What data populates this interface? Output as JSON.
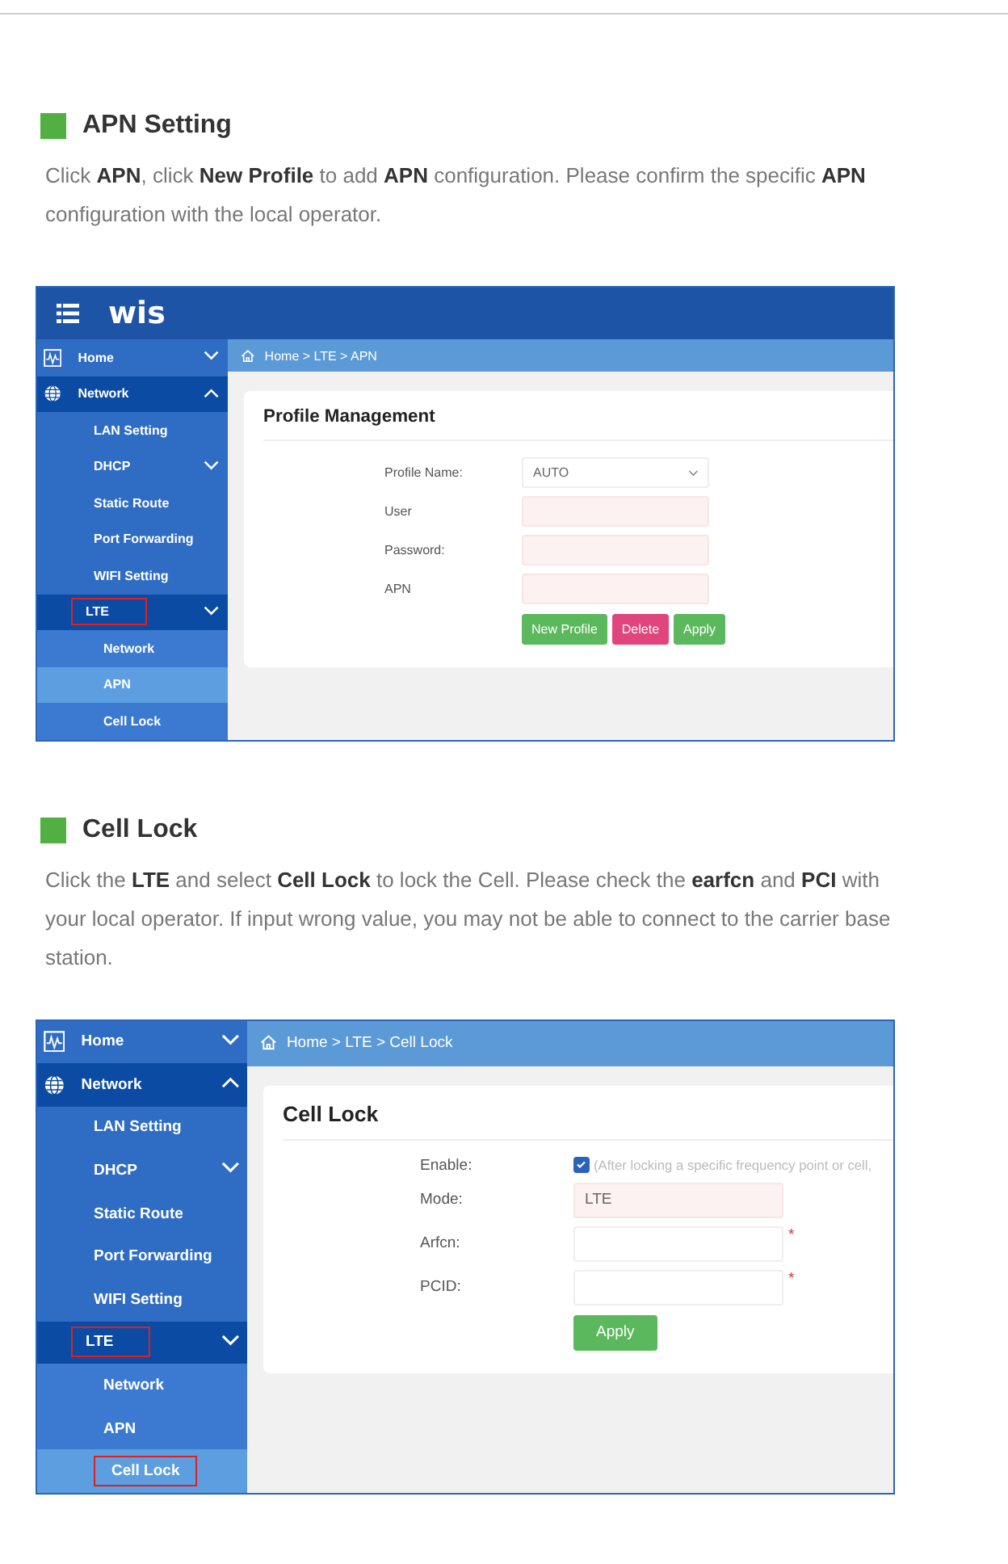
{
  "sections": [
    {
      "heading": "APN Setting",
      "text": "Click **APN**, click **New Profile** to add **APN** configuration. Please confirm the specific **APN** configuration with the local operator.",
      "screenshot": {
        "top_bar": {
          "logo": "wis"
        },
        "sidebar": [
          {
            "label": "Home",
            "kind": "group",
            "expanded": false,
            "active": false,
            "selected": false,
            "outlined": false
          },
          {
            "label": "Network",
            "kind": "group",
            "expanded": true,
            "active": true,
            "selected": false,
            "outlined": false
          },
          {
            "label": "LAN Setting",
            "kind": "item",
            "active": false,
            "selected": false,
            "outlined": false
          },
          {
            "label": "DHCP",
            "kind": "item",
            "expanded": false,
            "active": false,
            "selected": false,
            "outlined": false
          },
          {
            "label": "Static Route",
            "kind": "item",
            "active": false,
            "selected": false,
            "outlined": false
          },
          {
            "label": "Port Forwarding",
            "kind": "item",
            "active": false,
            "selected": false,
            "outlined": false
          },
          {
            "label": "WIFI Setting",
            "kind": "item",
            "active": false,
            "selected": false,
            "outlined": false
          },
          {
            "label": "LTE",
            "kind": "item",
            "expanded": false,
            "active": true,
            "selected": false,
            "outlined": true
          },
          {
            "label": "Network",
            "kind": "subitem",
            "active": false,
            "selected": false,
            "outlined": false
          },
          {
            "label": "APN",
            "kind": "subitem",
            "active": false,
            "selected": true,
            "outlined": false
          },
          {
            "label": "Cell Lock",
            "kind": "subitem",
            "active": false,
            "selected": false,
            "outlined": false
          }
        ],
        "breadcrumb": "Home > LTE > APN",
        "card": {
          "title": "Profile Management",
          "fields": [
            {
              "label": "Profile Name:",
              "kind": "select",
              "value": "AUTO",
              "highlighted": false
            },
            {
              "label": "User",
              "kind": "input",
              "highlighted": true
            },
            {
              "label": "Password:",
              "kind": "input",
              "highlighted": true
            },
            {
              "label": "APN",
              "kind": "input",
              "highlighted": true
            }
          ],
          "buttons": [
            {
              "label": "New Profile",
              "color": "#5cb85c"
            },
            {
              "label": "Delete",
              "color": "#e0457b"
            },
            {
              "label": "Apply",
              "color": "#5cb85c"
            }
          ]
        }
      }
    },
    {
      "heading": "Cell Lock",
      "text": "Click the **LTE** and select **Cell Lock** to lock the Cell. Please check the **earfcn** and **PCI** with your local operator. If input wrong value, you may not be able to connect to the carrier base station.",
      "screenshot": {
        "sidebar": [
          {
            "label": "Home",
            "kind": "group",
            "expanded": false,
            "active": false,
            "selected": false,
            "outlined": false
          },
          {
            "label": "Network",
            "kind": "group",
            "expanded": true,
            "active": true,
            "selected": false,
            "outlined": false
          },
          {
            "label": "LAN Setting",
            "kind": "item",
            "active": false,
            "selected": false,
            "outlined": false
          },
          {
            "label": "DHCP",
            "kind": "item",
            "expanded": false,
            "active": false,
            "selected": false,
            "outlined": false
          },
          {
            "label": "Static Route",
            "kind": "item",
            "active": false,
            "selected": false,
            "outlined": false
          },
          {
            "label": "Port Forwarding",
            "kind": "item",
            "active": false,
            "selected": false,
            "outlined": false
          },
          {
            "label": "WIFI Setting",
            "kind": "item",
            "active": false,
            "selected": false,
            "outlined": false
          },
          {
            "label": "LTE",
            "kind": "item",
            "expanded": false,
            "active": true,
            "selected": false,
            "outlined": true
          },
          {
            "label": "Network",
            "kind": "subitem",
            "active": false,
            "selected": false,
            "outlined": false
          },
          {
            "label": "APN",
            "kind": "subitem",
            "active": false,
            "selected": false,
            "outlined": false
          },
          {
            "label": "Cell Lock",
            "kind": "subitem",
            "active": false,
            "selected": true,
            "outlined": true
          }
        ],
        "breadcrumb": "Home > LTE > Cell Lock",
        "card": {
          "title": "Cell Lock",
          "fields": [
            {
              "label": "Enable:",
              "kind": "checkbox",
              "checked": true,
              "hint": "(After locking a specific frequency point or cell,"
            },
            {
              "label": "Mode:",
              "kind": "input",
              "value": "LTE",
              "highlighted": true
            },
            {
              "label": "Arfcn:",
              "kind": "input",
              "highlighted": false,
              "required_mark": "*"
            },
            {
              "label": "PCID:",
              "kind": "input",
              "highlighted": false,
              "required_mark": "*"
            }
          ],
          "buttons": [
            {
              "label": "Apply",
              "color": "#5cb85c"
            }
          ]
        }
      }
    }
  ]
}
